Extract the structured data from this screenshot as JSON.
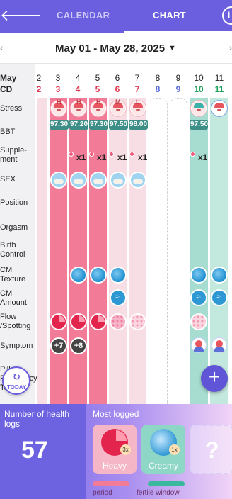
{
  "header": {
    "tab_calendar": "CALENDAR",
    "tab_chart": "CHART",
    "back_icon": "arrow-left-icon",
    "info_icon": "info-icon"
  },
  "range": {
    "label": "May 01 - May 28, 2025",
    "caret": "▼"
  },
  "grid": {
    "month_label": "May",
    "cd_label": "CD",
    "days": [
      {
        "day": "2",
        "cd": "2",
        "cd_color": "#e0344f"
      },
      {
        "day": "3",
        "cd": "3",
        "cd_color": "#e0344f"
      },
      {
        "day": "4",
        "cd": "4",
        "cd_color": "#e0344f"
      },
      {
        "day": "5",
        "cd": "5",
        "cd_color": "#e0344f"
      },
      {
        "day": "6",
        "cd": "6",
        "cd_color": "#e0344f"
      },
      {
        "day": "7",
        "cd": "7",
        "cd_color": "#e0344f"
      },
      {
        "day": "8",
        "cd": "8",
        "cd_color": "#5b6fd8"
      },
      {
        "day": "9",
        "cd": "9",
        "cd_color": "#5b6fd8"
      },
      {
        "day": "10",
        "cd": "10",
        "cd_color": "#1fa35b"
      },
      {
        "day": "11",
        "cd": "11",
        "cd_color": "#1fa35b"
      }
    ],
    "row_labels": [
      "Stress",
      "BBT",
      "Supple-\nment",
      "SEX",
      "Position",
      "Orgasm",
      "Birth\nControl",
      "CM\nTexture",
      "CM\nAmount",
      "Flow\n/Spotting",
      "Symptom",
      "Pill",
      "Pregnancy\nTest"
    ],
    "stress": [
      {
        "letter": "H"
      },
      {
        "letter": "H"
      },
      {
        "letter": "H"
      },
      {
        "letter": "M"
      },
      {
        "letter": "L"
      }
    ],
    "bbt": [
      "97.30",
      "97.20",
      "97.30",
      "97.50",
      "98.00",
      "97.50"
    ],
    "supplement": "x1",
    "symptoms": [
      "+7",
      "+8"
    ]
  },
  "buttons": {
    "today_label": "TODAY",
    "fab_label": "+"
  },
  "summary": {
    "logs_title": "Number of health logs",
    "logs_count": "57",
    "most_title": "Most logged",
    "cards": [
      {
        "label": "Heavy",
        "count": "3x"
      },
      {
        "label": "Creamy",
        "count": "1x"
      },
      {
        "label": "?",
        "count": ""
      }
    ],
    "legend_period": "period",
    "legend_fertile": "fertile window",
    "colors": {
      "period": "#f27b98",
      "fertile": "#3bb99f",
      "accent": "#6b5fe0"
    }
  }
}
